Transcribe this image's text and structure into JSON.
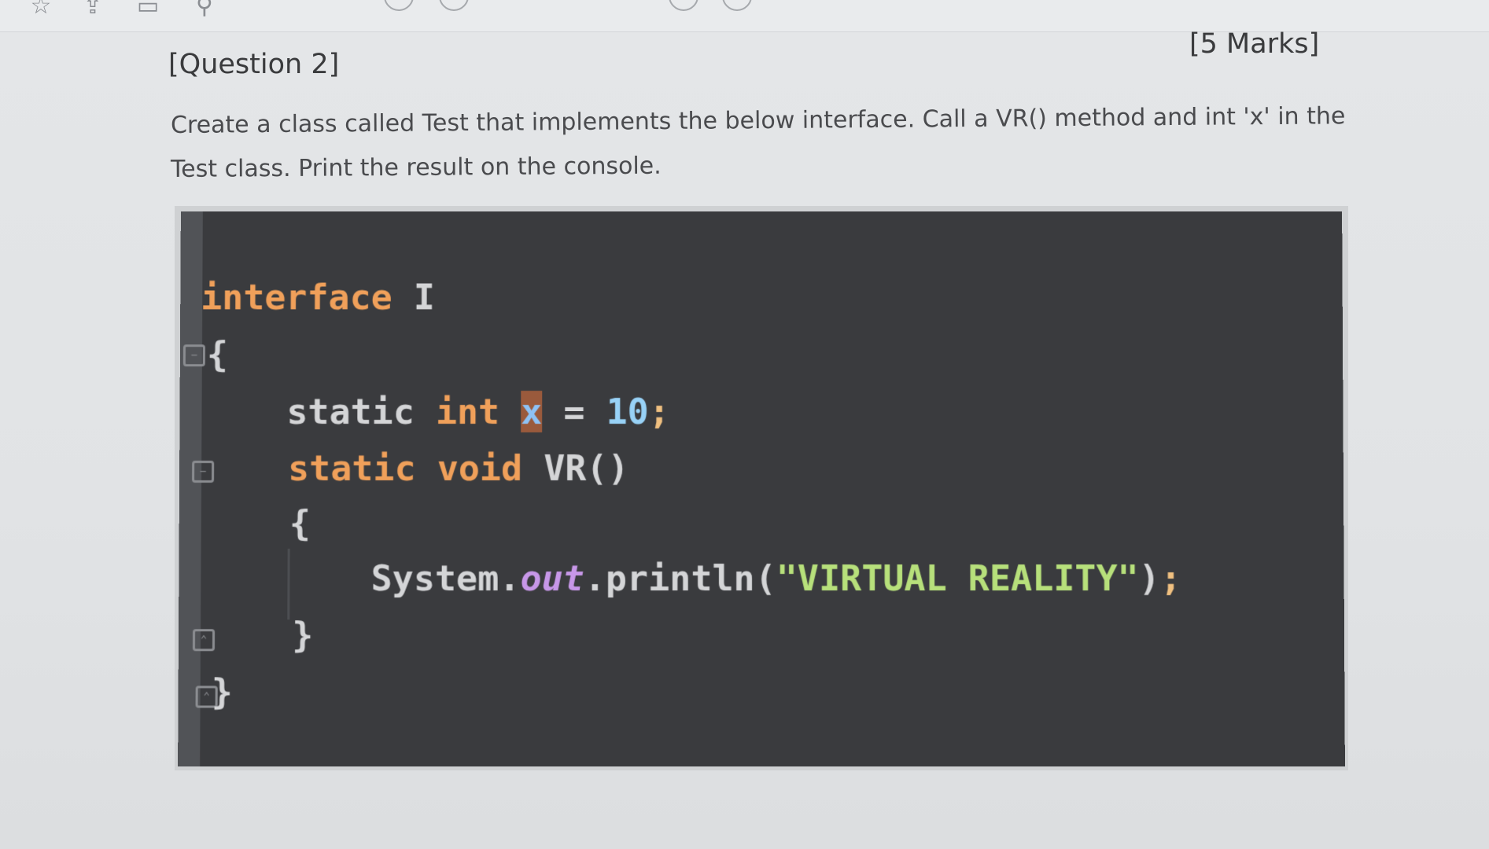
{
  "question": {
    "label": "[Question 2]",
    "marks": "[5 Marks]",
    "text_line1": "Create a class called Test that implements the below interface. Call a VR() method and int 'x' in the",
    "text_line2": "Test class. Print the result on the console."
  },
  "toolbar": {
    "icons": [
      "star-icon",
      "share-icon",
      "print-icon",
      "search-icon"
    ]
  },
  "code": {
    "line1_kw": "interface",
    "line1_name": " I",
    "line2": "{",
    "line3_kw1": "static",
    "line3_kw2": "int",
    "line3_var": "x",
    "line3_eq": " = ",
    "line3_num": "10",
    "line3_semi": ";",
    "line4_kw1": "static",
    "line4_kw2": "void",
    "line4_name": "VR()",
    "line5": "{",
    "line6_class": "System.",
    "line6_field": "out",
    "line6_method": ".println(",
    "line6_string": "\"VIRTUAL REALITY\"",
    "line6_close": ")",
    "line6_semi": ";",
    "line7": "}",
    "line8": "}"
  },
  "colors": {
    "keyword": "#f0a05a",
    "string": "#b7e07b",
    "number": "#98d2f7",
    "field": "#c797e8",
    "panel_bg": "#3a3b3e"
  }
}
